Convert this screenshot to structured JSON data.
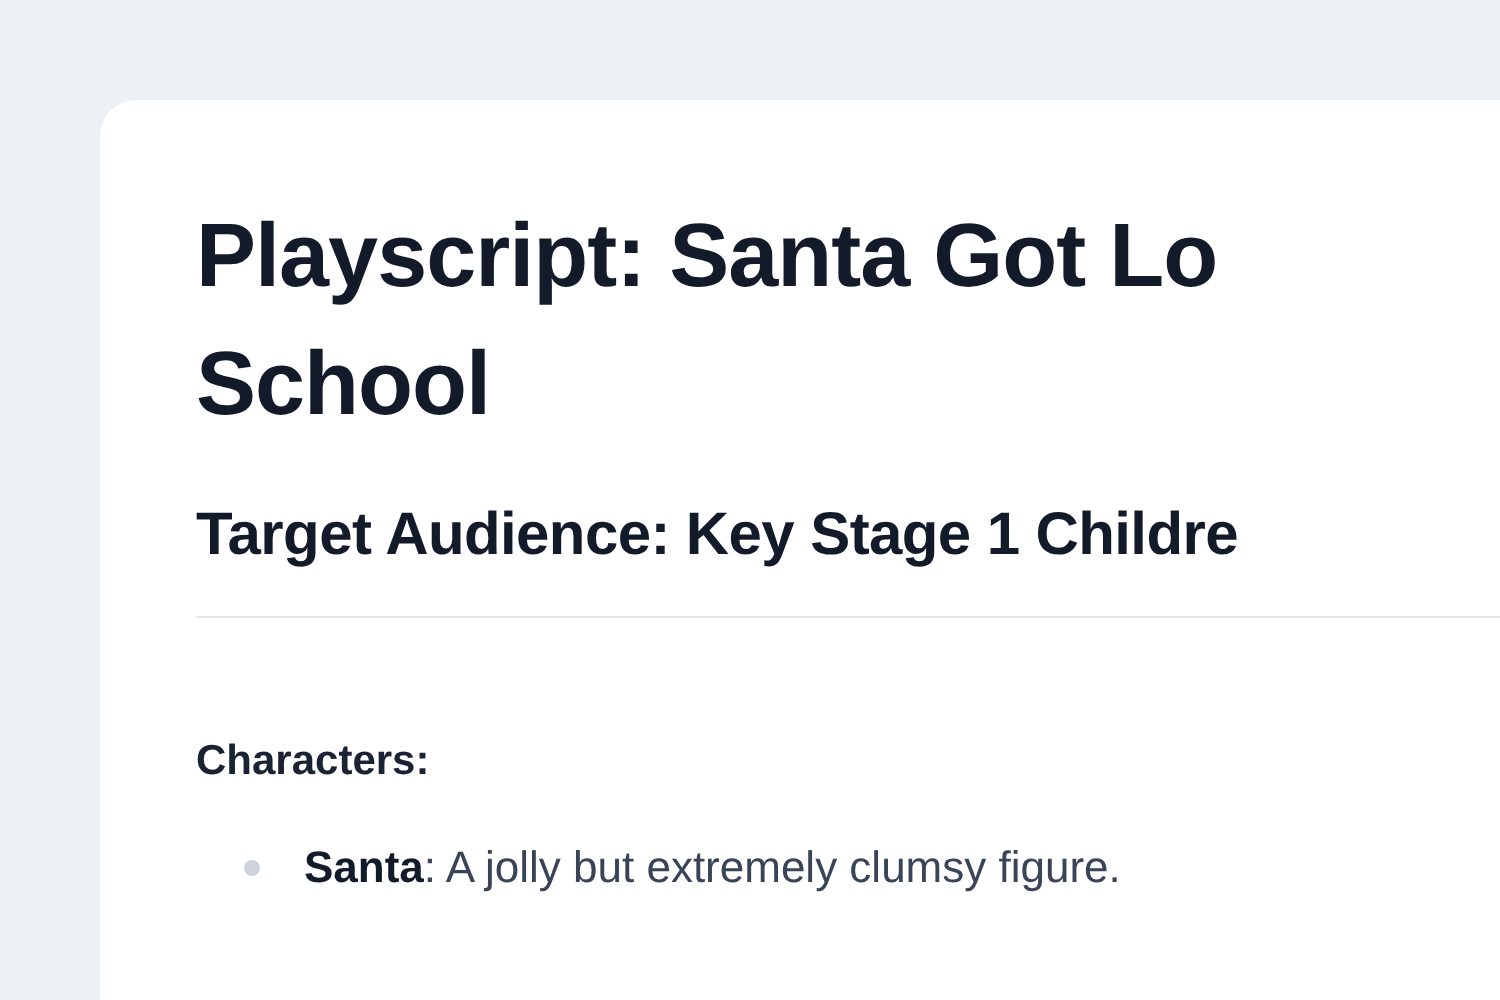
{
  "title_lines": [
    "Playscript: Santa Got Lo",
    "School"
  ],
  "subtitle": "Target Audience: Key Stage 1 Childre",
  "section_heading": "Characters:",
  "characters": [
    {
      "name": "Santa",
      "description": ": A jolly but extremely clumsy figure."
    }
  ]
}
